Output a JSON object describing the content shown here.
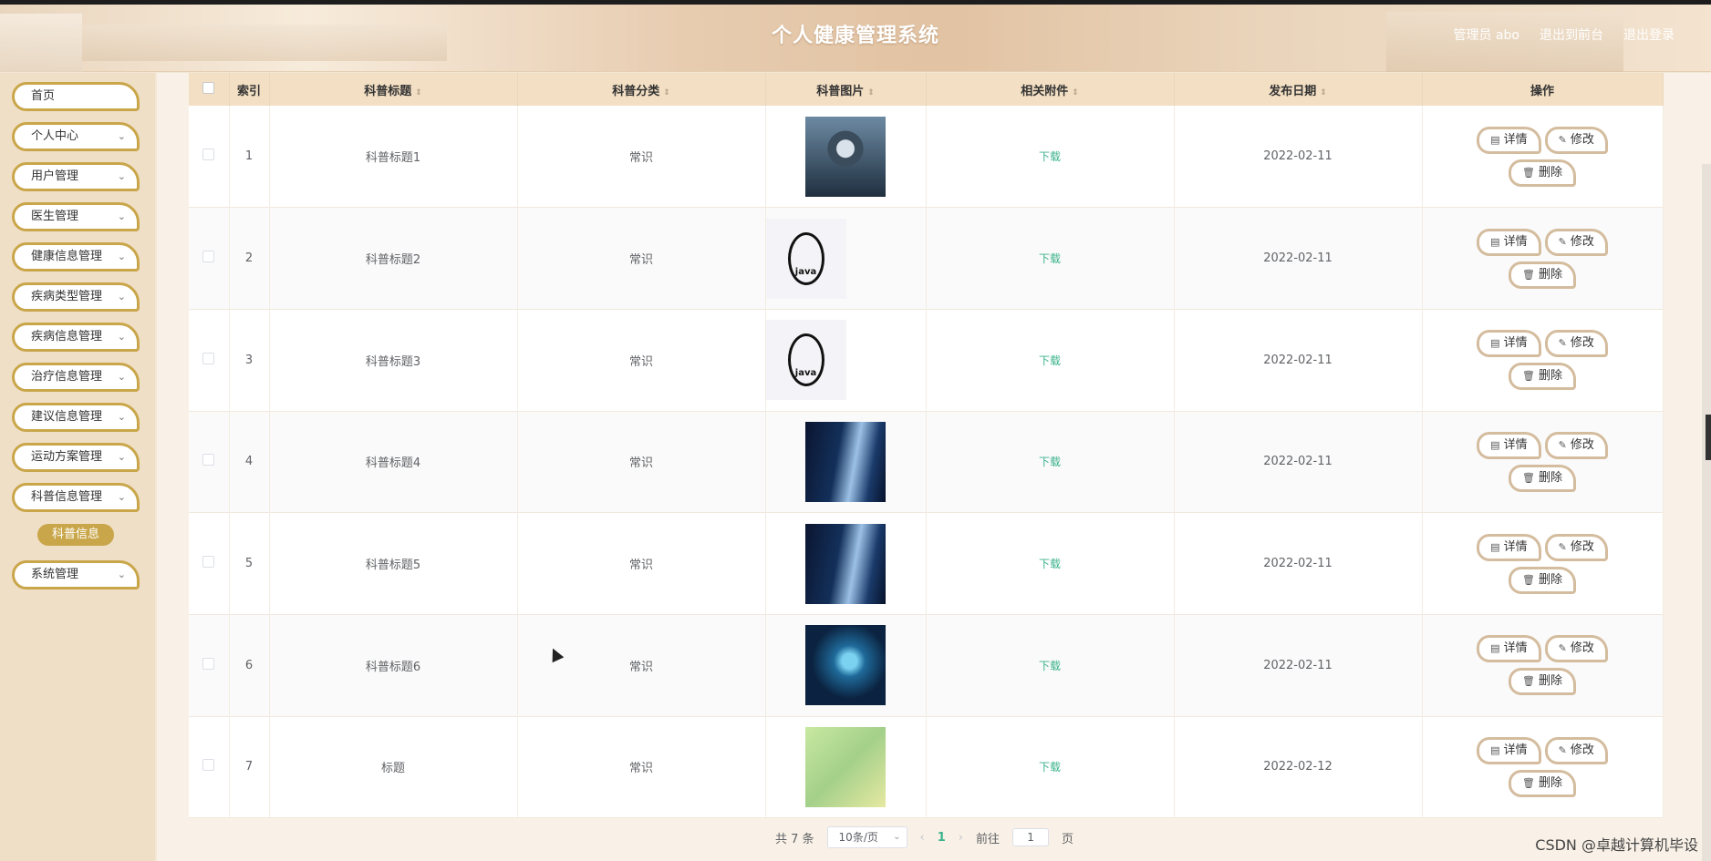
{
  "app": {
    "title": "个人健康管理系统",
    "admin_label": "管理员 abo",
    "exit_front": "退出到前台",
    "logout": "退出登录"
  },
  "sidebar": {
    "items": [
      {
        "label": "首页",
        "has_chevron": false
      },
      {
        "label": "个人中心",
        "has_chevron": true
      },
      {
        "label": "用户管理",
        "has_chevron": true
      },
      {
        "label": "医生管理",
        "has_chevron": true
      },
      {
        "label": "健康信息管理",
        "has_chevron": true
      },
      {
        "label": "疾病类型管理",
        "has_chevron": true
      },
      {
        "label": "疾病信息管理",
        "has_chevron": true
      },
      {
        "label": "治疗信息管理",
        "has_chevron": true
      },
      {
        "label": "建议信息管理",
        "has_chevron": true
      },
      {
        "label": "运动方案管理",
        "has_chevron": true
      },
      {
        "label": "科普信息管理",
        "has_chevron": true
      },
      {
        "label": "系统管理",
        "has_chevron": true
      }
    ],
    "active_sub": "科普信息",
    "chevron_icon": "chevron-down-icon"
  },
  "table": {
    "headers": {
      "index": "索引",
      "title": "科普标题",
      "category": "科普分类",
      "image": "科普图片",
      "attachment": "相关附件",
      "date": "发布日期",
      "ops": "操作"
    },
    "rows": [
      {
        "index": "1",
        "title": "科普标题1",
        "category": "常识",
        "image": "hacker-photo",
        "attachment": "下载",
        "date": "2022-02-11"
      },
      {
        "index": "2",
        "title": "科普标题2",
        "category": "常识",
        "image": "java-logo",
        "attachment": "下载",
        "date": "2022-02-11"
      },
      {
        "index": "3",
        "title": "科普标题3",
        "category": "常识",
        "image": "java-logo",
        "attachment": "下载",
        "date": "2022-02-11"
      },
      {
        "index": "4",
        "title": "科普标题4",
        "category": "常识",
        "image": "code-stream",
        "attachment": "下载",
        "date": "2022-02-11"
      },
      {
        "index": "5",
        "title": "科普标题5",
        "category": "常识",
        "image": "code-stream",
        "attachment": "下载",
        "date": "2022-02-11"
      },
      {
        "index": "6",
        "title": "科普标题6",
        "category": "常识",
        "image": "ai-head",
        "attachment": "下载",
        "date": "2022-02-11"
      },
      {
        "index": "7",
        "title": "标题",
        "category": "常识",
        "image": "map",
        "attachment": "下载",
        "date": "2022-02-12"
      }
    ],
    "buttons": {
      "detail": "详情",
      "edit": "修改",
      "delete": "删除"
    }
  },
  "pager": {
    "total": "共 7 条",
    "page_size": "10条/页",
    "current_page": "1",
    "goto_label": "前往",
    "goto_value": "1",
    "page_suffix": "页"
  },
  "watermark": "CSDN @卓越计算机毕设",
  "colors": {
    "accent": "#c9a64a",
    "link": "#3bb28c",
    "header_bg": "#f3dfc3"
  }
}
